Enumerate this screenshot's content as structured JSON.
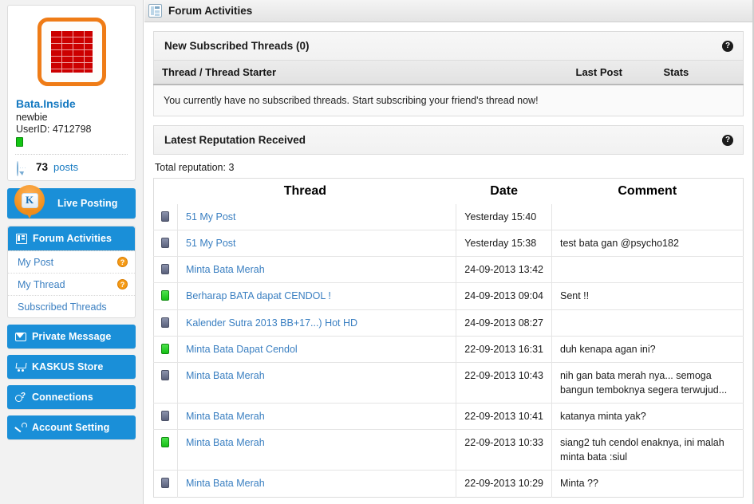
{
  "sidebar": {
    "profile": {
      "avatar_icon": "red-brick-wall-avatar",
      "username": "Bata.Inside",
      "rank": "newbie",
      "userid_label": "UserID: 4712798",
      "online_status": "online",
      "posts_count": "73",
      "posts_label": "posts",
      "posts_icon": "comment-bubble-icon"
    },
    "live_posting": {
      "label": "Live Posting",
      "icon": "kaskus-pin-icon"
    },
    "forum_activities": {
      "label": "Forum Activities",
      "icon": "panel-icon",
      "sub_items": [
        {
          "label": "My Post",
          "badge_icon": "question-mark-icon",
          "has_badge": true
        },
        {
          "label": "My Thread",
          "badge_icon": "question-mark-icon",
          "has_badge": true
        },
        {
          "label": "Subscribed Threads",
          "has_badge": false
        }
      ]
    },
    "nav_buttons": [
      {
        "label": "Private Message",
        "icon": "envelope-icon"
      },
      {
        "label": "KASKUS Store",
        "icon": "shopping-cart-icon"
      },
      {
        "label": "Connections",
        "icon": "connections-icon"
      },
      {
        "label": "Account Setting",
        "icon": "wrench-icon"
      }
    ]
  },
  "header": {
    "title": "Forum Activities",
    "icon": "panel-icon"
  },
  "subscribed_panel": {
    "title": "New Subscribed Threads (0)",
    "help_icon": "help-question-icon",
    "columns": [
      "Thread / Thread Starter",
      "Last Post",
      "Stats"
    ],
    "empty_message": "You currently have no subscribed threads. Start subscribing your friend's thread now!"
  },
  "reputation_panel": {
    "title": "Latest Reputation Received",
    "help_icon": "help-question-icon",
    "total_reputation_label": "Total reputation:",
    "total_reputation_value": "3",
    "columns": [
      "Thread",
      "Date",
      "Comment"
    ],
    "rows": [
      {
        "status": "gray",
        "thread": "51 My Post",
        "date": "Yesterday 15:40",
        "comment": ""
      },
      {
        "status": "gray",
        "thread": "51 My Post",
        "date": "Yesterday 15:38",
        "comment": "test bata gan @psycho182"
      },
      {
        "status": "gray",
        "thread": "Minta Bata Merah",
        "date": "24-09-2013 13:42",
        "comment": ""
      },
      {
        "status": "green",
        "thread": "Berharap BATA dapat CENDOL !",
        "date": "24-09-2013 09:04",
        "comment": "Sent !!"
      },
      {
        "status": "gray",
        "thread": "Kalender Sutra 2013 BB+17...) Hot HD",
        "date": "24-09-2013 08:27",
        "comment": ""
      },
      {
        "status": "green",
        "thread": "Minta Bata Dapat Cendol",
        "date": "22-09-2013 16:31",
        "comment": "duh kenapa agan ini?"
      },
      {
        "status": "gray",
        "thread": "Minta Bata Merah",
        "date": "22-09-2013 10:43",
        "comment": "nih gan bata merah nya... semoga bangun temboknya segera terwujud..."
      },
      {
        "status": "gray",
        "thread": "Minta Bata Merah",
        "date": "22-09-2013 10:41",
        "comment": "katanya minta yak?"
      },
      {
        "status": "green",
        "thread": "Minta Bata Merah",
        "date": "22-09-2013 10:33",
        "comment": "siang2 tuh cendol enaknya, ini malah minta bata :siul"
      },
      {
        "status": "gray",
        "thread": "Minta Bata Merah",
        "date": "22-09-2013 10:29",
        "comment": "Minta ??"
      }
    ]
  },
  "colors": {
    "brand_blue": "#1a8fd8",
    "link_blue": "#3a7fc1",
    "accent_orange": "#ef7c17",
    "status_green": "#16bf16",
    "brick_red": "#cc0000"
  }
}
